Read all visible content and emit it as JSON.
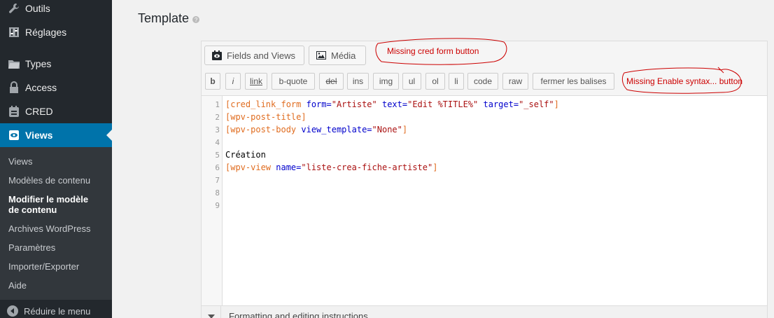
{
  "sidebar": {
    "top_items": [
      {
        "label": "Outils",
        "icon": "wrench-icon"
      },
      {
        "label": "Réglages",
        "icon": "settings-icon"
      },
      {
        "label": "Types",
        "icon": "folder-icon"
      },
      {
        "label": "Access",
        "icon": "lock-icon"
      },
      {
        "label": "CRED",
        "icon": "cred-icon"
      },
      {
        "label": "Views",
        "icon": "eye-icon",
        "current": true
      }
    ],
    "submenu": [
      {
        "label": "Views"
      },
      {
        "label": "Modèles de contenu"
      },
      {
        "label": "Modifier le modèle",
        "label2": "de contenu",
        "active": true
      },
      {
        "label": "Archives WordPress"
      },
      {
        "label": "Paramètres"
      },
      {
        "label": "Importer/Exporter"
      },
      {
        "label": "Aide"
      }
    ],
    "collapse_label": "Réduire le menu"
  },
  "main": {
    "title": "Template",
    "media_buttons": [
      {
        "label": "Fields and Views",
        "icon": "fields-views-icon"
      },
      {
        "label": "Média",
        "icon": "image-icon"
      }
    ],
    "quicktags": [
      "b",
      "i",
      "link",
      "b-quote",
      "del",
      "ins",
      "img",
      "ul",
      "ol",
      "li",
      "code",
      "raw",
      "fermer les balises"
    ],
    "line_numbers": [
      "1",
      "2",
      "3",
      "4",
      "5",
      "6",
      "7",
      "8",
      "9"
    ],
    "code": {
      "l1_a": "[cred_link_form ",
      "l1_attr1": "form=",
      "l1_val1": "\"Artiste\"",
      "l1_attr2": " text=",
      "l1_val2": "\"Edit %TITLE%\"",
      "l1_attr3": " target=",
      "l1_val3": "\"_self\"",
      "l1_end": "]",
      "l2": "[wpv-post-title]",
      "l3_a": "[wpv-post-body ",
      "l3_attr": "view_template=",
      "l3_val": "\"None\"",
      "l3_end": "]",
      "l5": "Création",
      "l6_a": "[wpv-view ",
      "l6_attr": "name=",
      "l6_val": "\"liste-crea-fiche-artiste\"",
      "l6_end": "]"
    },
    "instructions": "Formatting and editing instructions"
  },
  "annotations": {
    "a1": "Missing cred form button",
    "a2": "Missing Enable syntax... button"
  },
  "colors": {
    "accent": "#0073aa",
    "sidebar": "#23282d",
    "annotation": "#cc0000"
  }
}
